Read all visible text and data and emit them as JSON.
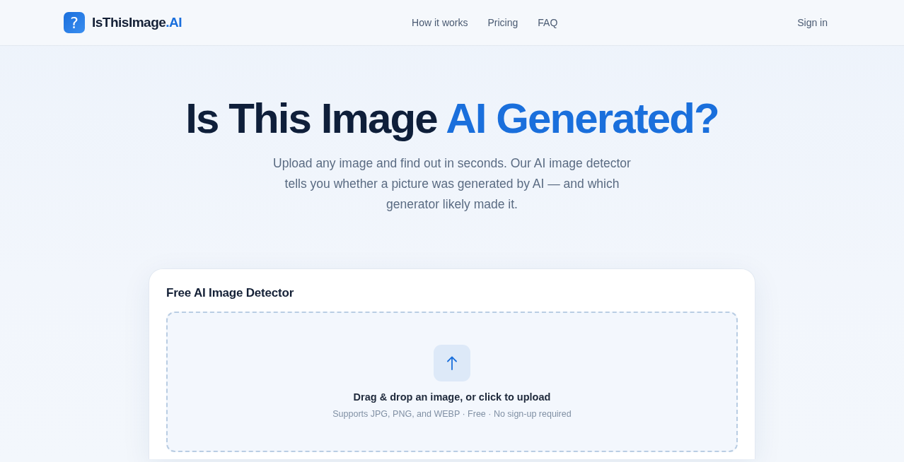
{
  "header": {
    "logo": {
      "mark": "?",
      "name": "IsThisImage",
      "accent": ".AI"
    },
    "nav": [
      "How it works",
      "Pricing",
      "FAQ"
    ],
    "sign_in": "Sign in"
  },
  "hero": {
    "title": "Is This Image",
    "title_accent": "AI Generated?",
    "subtitle": "Upload any image and find out in seconds. Our AI image detector tells you whether a picture was generated by AI — and which generator likely made it."
  },
  "detector": {
    "title": "Free AI Image Detector",
    "dropzone": {
      "prompt": "Drag & drop an image, or click to upload",
      "hint": "Supports JPG, PNG, and WEBP · Free · No sign-up required"
    }
  }
}
